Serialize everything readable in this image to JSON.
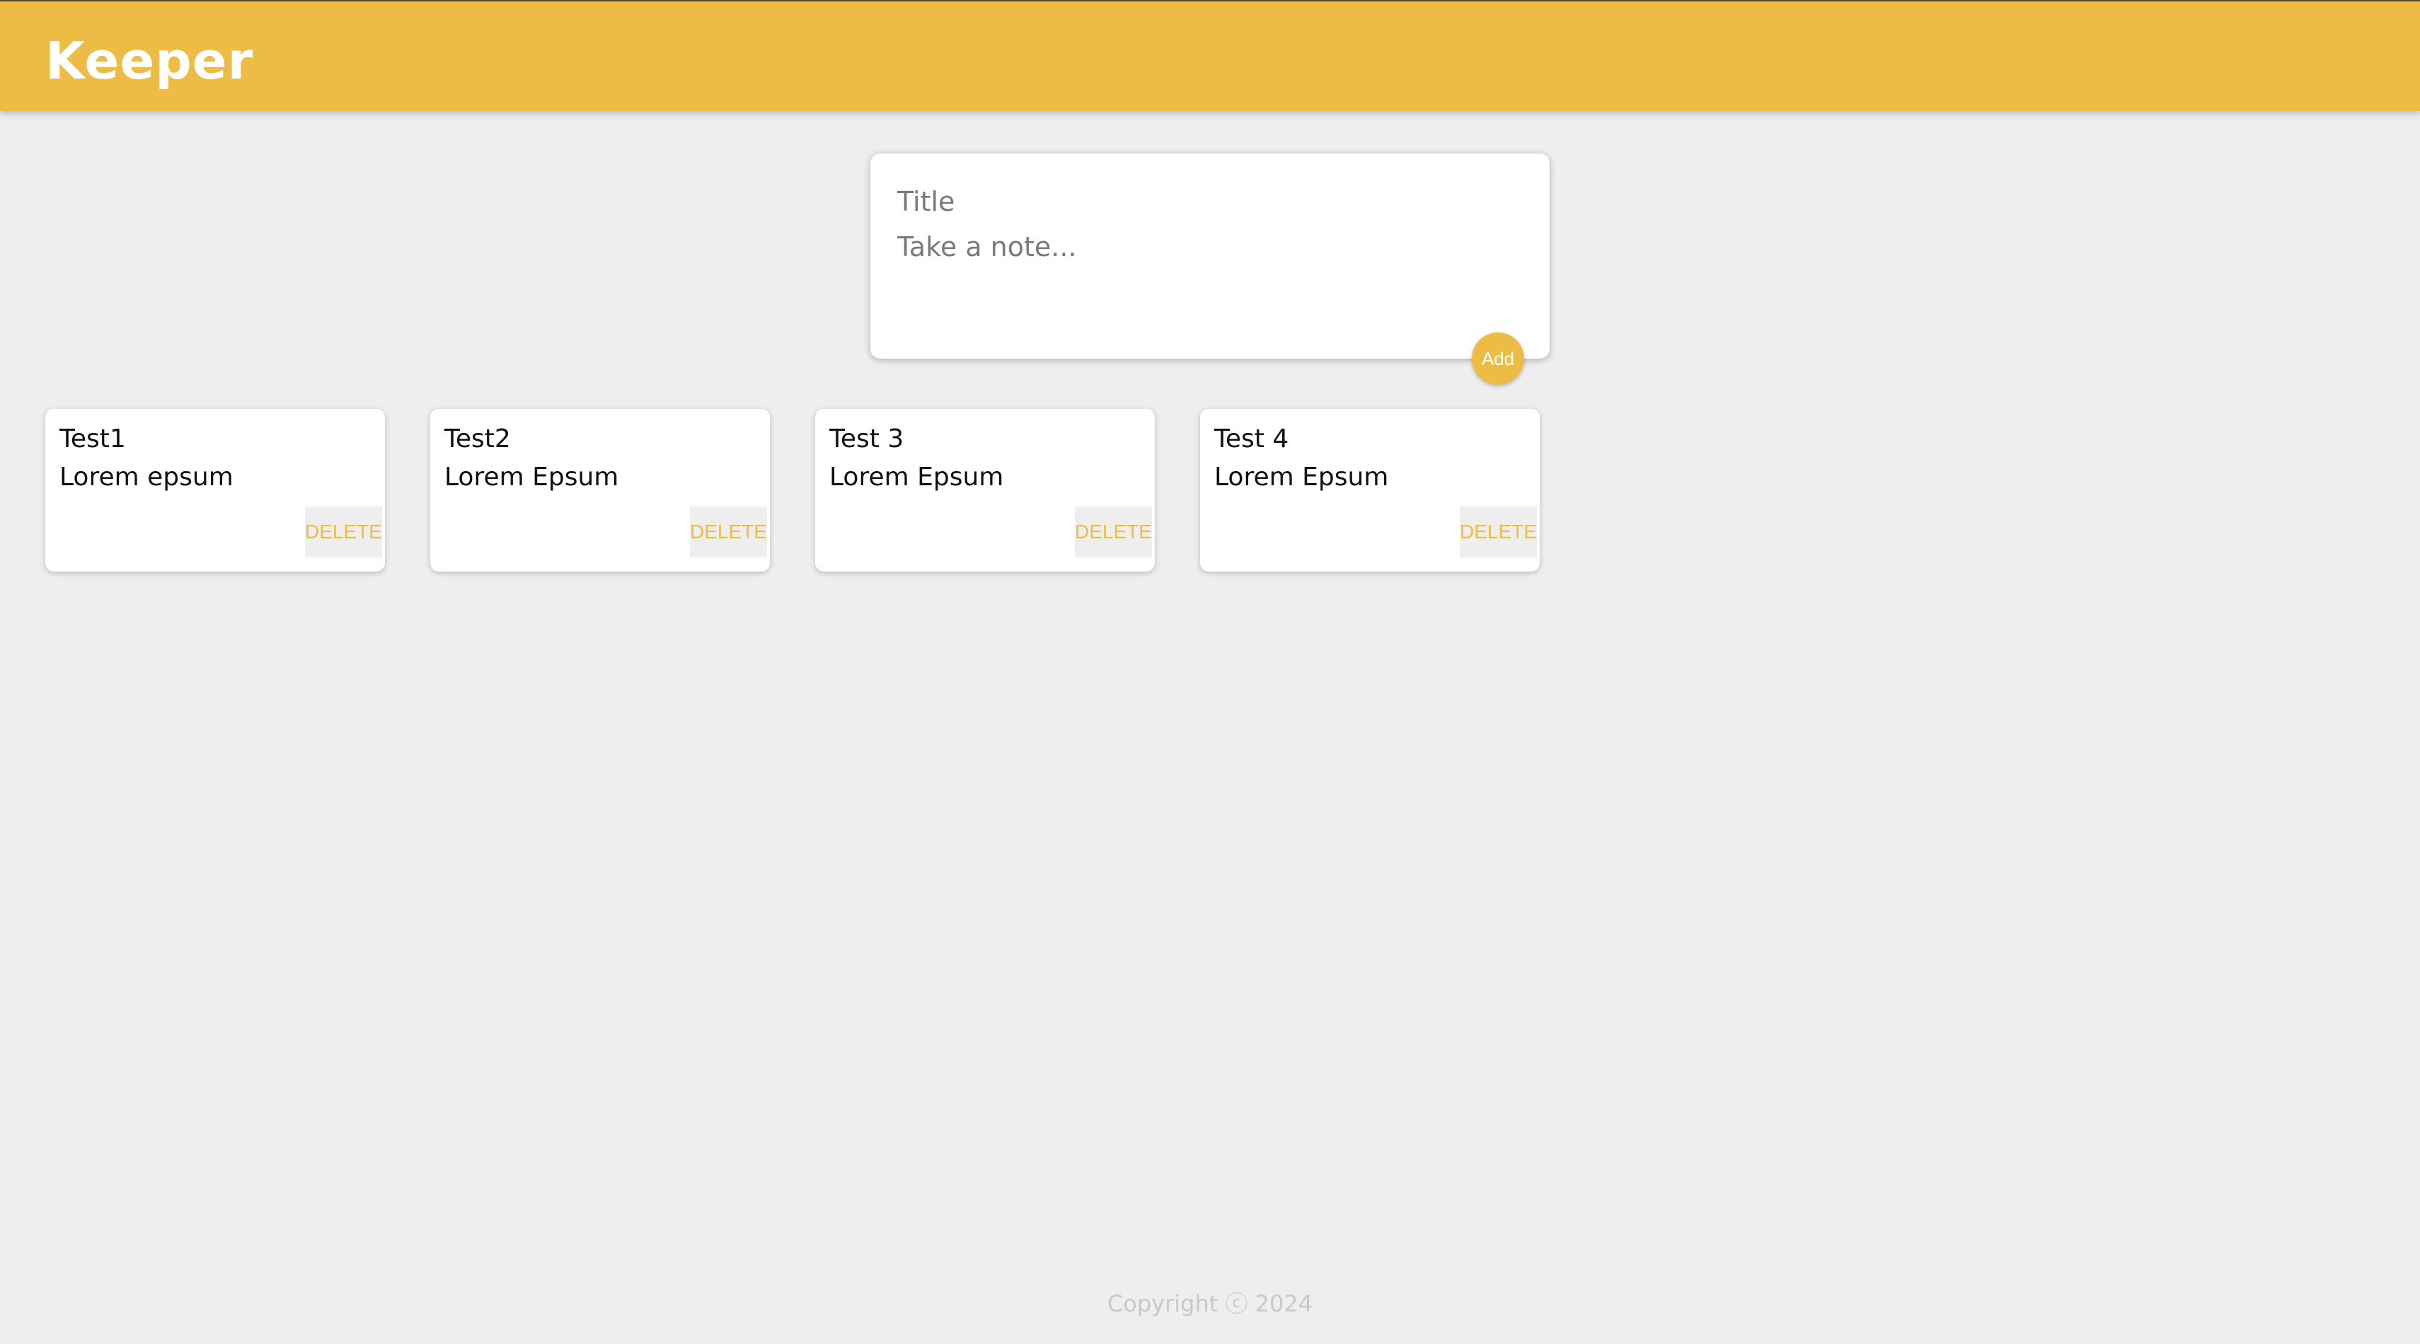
{
  "header": {
    "brand": "Keeper"
  },
  "composer": {
    "title_placeholder": "Title",
    "content_placeholder": "Take a note...",
    "add_label": "Add"
  },
  "notes": [
    {
      "title": "Test1",
      "content": "Lorem epsum",
      "delete_label": "DELETE"
    },
    {
      "title": "Test2",
      "content": "Lorem Epsum",
      "delete_label": "DELETE"
    },
    {
      "title": "Test 3",
      "content": "Lorem Epsum",
      "delete_label": "DELETE"
    },
    {
      "title": "Test 4",
      "content": "Lorem Epsum",
      "delete_label": "DELETE"
    }
  ],
  "footer": {
    "copyright": "Copyright ⓒ 2024"
  },
  "colors": {
    "accent": "#ecbc45",
    "background": "#eeeeee",
    "card": "#ffffff"
  }
}
